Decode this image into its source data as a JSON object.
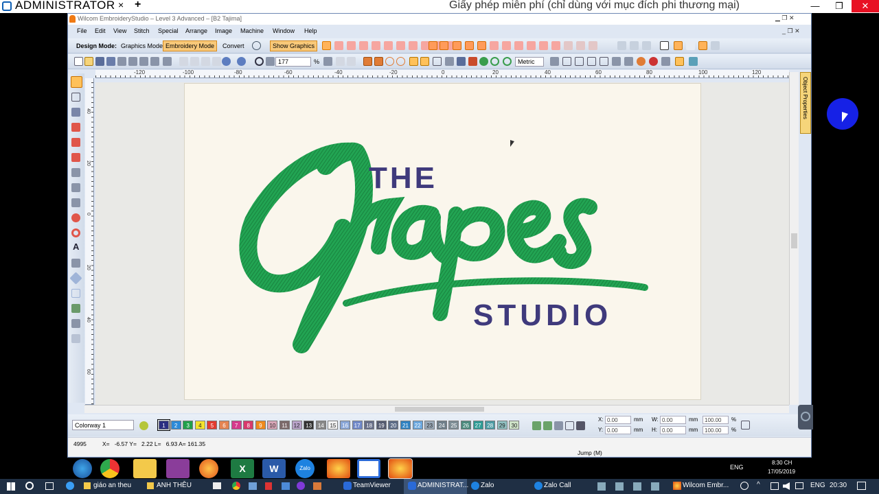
{
  "teamviewer": {
    "title": "ADMINISTRATOR",
    "tab_close": "×",
    "tab_add": "+",
    "license": "Giấy phép miễn phí (chỉ dùng với mục đích phi thương mại)"
  },
  "app": {
    "title": "Wilcom EmbroideryStudio – Level 3 Advanced – [B2     Tajima]",
    "menu": [
      "File",
      "Edit",
      "View",
      "Stitch",
      "Special",
      "Arrange",
      "Image",
      "Machine",
      "Window",
      "Help"
    ],
    "design_mode_label": "Design Mode:",
    "graphics_mode": "Graphics Mode",
    "embroidery_mode": "Embroidery Mode",
    "convert": "Convert",
    "show_graphics": "Show Graphics",
    "zoom_value": "177",
    "zoom_unit": "%",
    "metric": "Metric",
    "ruler_h": [
      "-120",
      "-100",
      "-80",
      "-60",
      "-40",
      "-20",
      "0",
      "20",
      "40",
      "60",
      "80",
      "100",
      "120"
    ],
    "ruler_v": [
      "40",
      "20",
      "0",
      "20",
      "40",
      "60"
    ],
    "object_properties": "Object Properties",
    "colorway": "Colorway 1",
    "swatches": [
      {
        "n": "1",
        "c": "#2b2f82"
      },
      {
        "n": "2",
        "c": "#2c8ad8"
      },
      {
        "n": "3",
        "c": "#21a04a"
      },
      {
        "n": "4",
        "c": "#f4e12b"
      },
      {
        "n": "5",
        "c": "#e23b2f"
      },
      {
        "n": "6",
        "c": "#e48451"
      },
      {
        "n": "7",
        "c": "#d63a8c"
      },
      {
        "n": "8",
        "c": "#d83a6c"
      },
      {
        "n": "9",
        "c": "#ef8a1d"
      },
      {
        "n": "10",
        "c": "#d9a6b8"
      },
      {
        "n": "11",
        "c": "#7c6a6a"
      },
      {
        "n": "12",
        "c": "#b9a3c9"
      },
      {
        "n": "13",
        "c": "#333333"
      },
      {
        "n": "14",
        "c": "#888888"
      },
      {
        "n": "15",
        "c": "#f3f3f3"
      },
      {
        "n": "16",
        "c": "#8aa7d8"
      },
      {
        "n": "17",
        "c": "#6f88c9"
      },
      {
        "n": "18",
        "c": "#666e88"
      },
      {
        "n": "19",
        "c": "#545b70"
      },
      {
        "n": "20",
        "c": "#5b6b86"
      },
      {
        "n": "21",
        "c": "#2f82c2"
      },
      {
        "n": "22",
        "c": "#6aa7de"
      },
      {
        "n": "23",
        "c": "#9aa9b8"
      },
      {
        "n": "24",
        "c": "#6f7f8a"
      },
      {
        "n": "25",
        "c": "#7d8d95"
      },
      {
        "n": "26",
        "c": "#4b8a7e"
      },
      {
        "n": "27",
        "c": "#2f9b95"
      },
      {
        "n": "28",
        "c": "#4b9aa3"
      },
      {
        "n": "29",
        "c": "#8fbfc0"
      },
      {
        "n": "30",
        "c": "#cfe3c8"
      }
    ],
    "coords": {
      "x_label": "X:",
      "y_label": "Y:",
      "w_label": "W:",
      "h_label": "H:",
      "x": "0.00",
      "y": "0.00",
      "w": "0.00",
      "h": "0.00",
      "unit": "mm",
      "pct1": "100.00",
      "pct2": "100.00",
      "pct": "%"
    },
    "status_left": "4995",
    "status_coords": "X=   -6.57 Y=   2.22 L=   6.93 A= 161.35",
    "status_right": "Jump (M)"
  },
  "logo": {
    "the": "THE",
    "script": "Grapes",
    "studio": "STUDIO",
    "green": "#22a453",
    "purple": "#3f3a7c"
  },
  "taskbar": {
    "items": [
      "giáo an theu",
      "ANH THÊU",
      "TeamViewer",
      "ADMINISTRAT...",
      "Zalo",
      "Zalo Call",
      "Wilcom Embr..."
    ],
    "quick_labels": {
      "word": "W",
      "excel": "X",
      "zalo": "Zalo"
    },
    "lang": "ENG",
    "time": "20:30",
    "clock_time": "8:30 CH",
    "clock_date": "17/05/2019"
  }
}
